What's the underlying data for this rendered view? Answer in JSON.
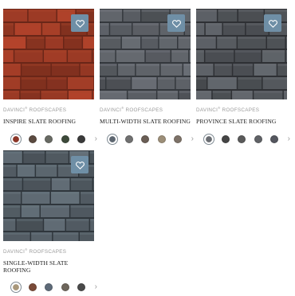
{
  "products": [
    {
      "brand": "DAVINCI",
      "brand_suffix": "ROOFSCAPES",
      "name": "INSPIRE SLATE ROOFING",
      "favorite_icon": "heart-icon",
      "tile_colors": {
        "base": "#9b3a25",
        "dark": "#6a2618",
        "light": "#a8442c"
      },
      "swatches": [
        "#8a3527",
        "#5b4a40",
        "#686a63",
        "#3d4a3a",
        "#3a3a3a"
      ],
      "selected_swatch": 0
    },
    {
      "brand": "DAVINCI",
      "brand_suffix": "ROOFSCAPES",
      "name": "MULTI-WIDTH SLATE ROOFING",
      "favorite_icon": "heart-icon",
      "tile_colors": {
        "base": "#5c6066",
        "dark": "#34383d",
        "light": "#7a7f86"
      },
      "swatches": [
        "#5d6670",
        "#707070",
        "#6a5e55",
        "#9c8e78",
        "#7d7268"
      ],
      "selected_swatch": 0
    },
    {
      "brand": "DAVINCI",
      "brand_suffix": "ROOFSCAPES",
      "name": "PROVINCE SLATE ROOFING",
      "favorite_icon": "heart-icon",
      "tile_colors": {
        "base": "#55595e",
        "dark": "#2e3034",
        "light": "#6d7176"
      },
      "swatches": [
        "#6a6d72",
        "#454545",
        "#5a5a5a",
        "#606266",
        "#55575f"
      ],
      "selected_swatch": 0
    },
    {
      "brand": "DAVINCI",
      "brand_suffix": "ROOFSCAPES",
      "name": "SINGLE-WIDTH SLATE ROOFING",
      "favorite_icon": "heart-icon",
      "tile_colors": {
        "base": "#566068",
        "dark": "#2f363c",
        "light": "#6e7b84"
      },
      "swatches": [
        "#a8977a",
        "#7a4a38",
        "#5e6a78",
        "#6e665c",
        "#4a4a4a"
      ],
      "selected_swatch": 0
    }
  ],
  "more_swatches_icon": "chevron-right-icon"
}
